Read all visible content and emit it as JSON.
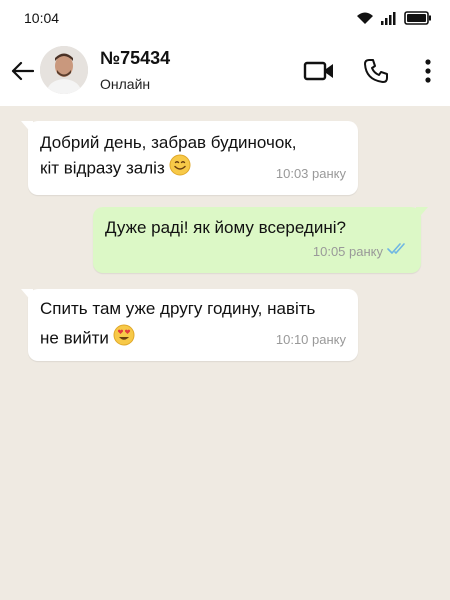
{
  "status_bar": {
    "time": "10:04"
  },
  "header": {
    "contact_name": "№75434",
    "contact_status": "Онлайн"
  },
  "messages": [
    {
      "direction": "incoming",
      "line1": "Добрий день, забрав будиночок,",
      "line2": "кіт відразу заліз",
      "emoji": "smiling-face-icon",
      "time": "10:03 ранку"
    },
    {
      "direction": "outgoing",
      "line1": "Дуже раді! як йому всередині?",
      "time": "10:05 ранку",
      "ticks": "double-check-icon"
    },
    {
      "direction": "incoming",
      "line1": "Спить там уже другу годину, навіть",
      "line2": "не вийти",
      "emoji": "heart-eyes-icon",
      "time": "10:10 ранку"
    }
  ],
  "colors": {
    "incoming_bubble": "#ffffff",
    "outgoing_bubble": "#dcf8c6",
    "background": "#efeae2",
    "read_ticks": "#6fb6e3"
  }
}
